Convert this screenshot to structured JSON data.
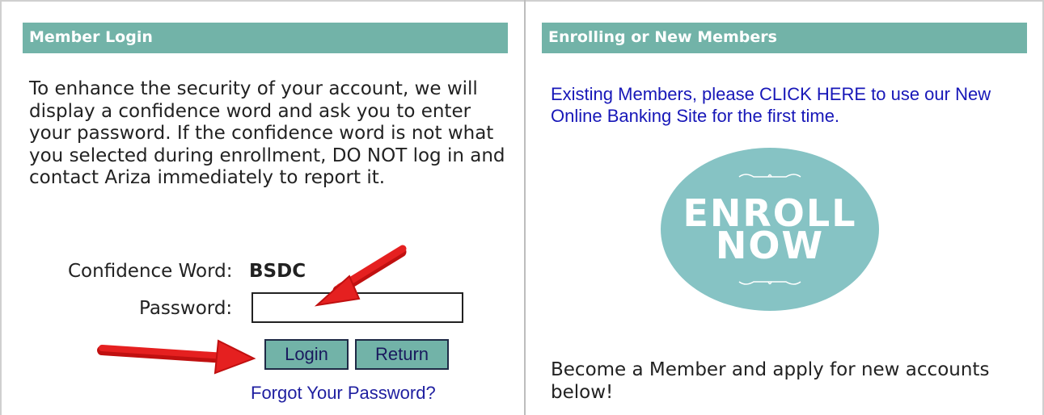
{
  "colors": {
    "header_bg": "#72b3a8",
    "button_bg": "#72b3a8",
    "link": "#1717b8",
    "badge": "#86c3c4",
    "arrow": "#e01b1b"
  },
  "member_login": {
    "header": "Member Login",
    "intro": "To enhance the security of your account, we will display a confidence word and ask you to enter your password. If the confidence word is not what you selected during enrollment, DO NOT log in and contact Ariza immediately to report it.",
    "confidence_label": "Confidence Word:",
    "confidence_value": "BSDC",
    "password_label": "Password:",
    "password_value": "",
    "login_button": "Login",
    "return_button": "Return",
    "forgot_link": "Forgot Your Password?"
  },
  "enrolling": {
    "header": "Enrolling or New Members",
    "existing_link": "Existing Members, please CLICK HERE to use our New Online Banking Site for the first time.",
    "badge_line1": "ENROLL",
    "badge_line2": "NOW",
    "become_text": "Become a Member and apply for new accounts below!"
  },
  "icons": [
    "red-arrow-icon",
    "flourish-icon"
  ]
}
